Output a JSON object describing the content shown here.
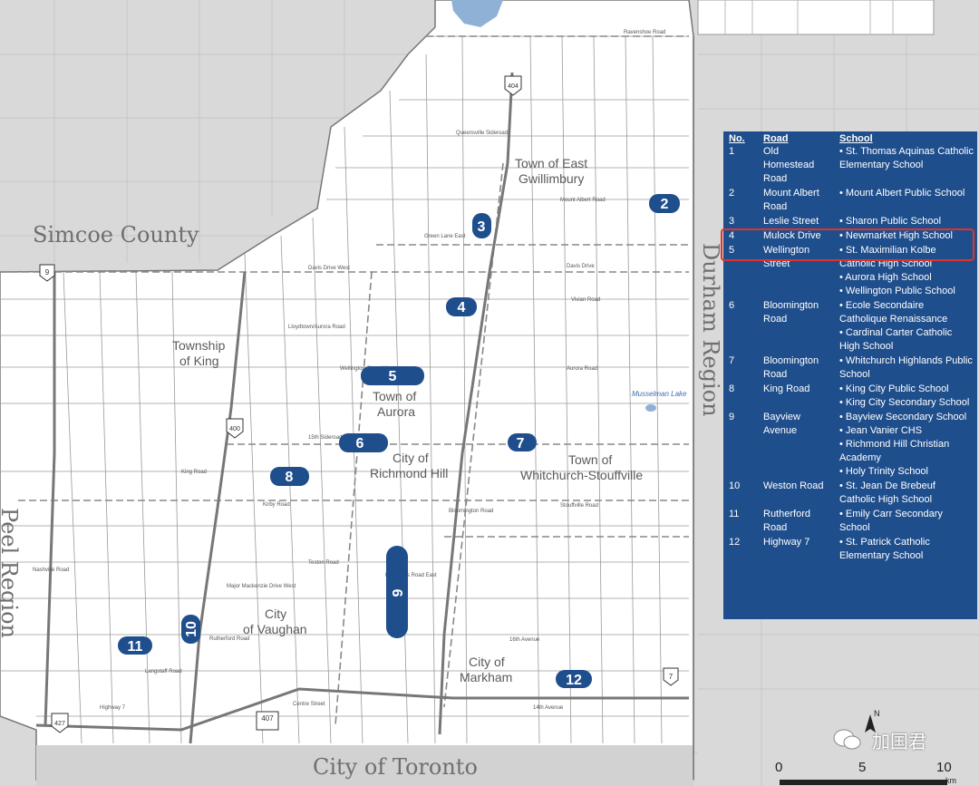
{
  "regions": {
    "simcoe": "Simcoe County",
    "durham": "Durham Region",
    "peel": "Peel Region",
    "toronto": "City of Toronto"
  },
  "towns": [
    {
      "id": "east_gwillimbury",
      "lines": [
        "Town of East",
        "Gwillimbury"
      ]
    },
    {
      "id": "king",
      "lines": [
        "Township",
        "of King"
      ]
    },
    {
      "id": "aurora",
      "lines": [
        "Town of",
        "Aurora"
      ]
    },
    {
      "id": "richmond_hill",
      "lines": [
        "City of",
        "Richmond Hill"
      ]
    },
    {
      "id": "whitchurch",
      "lines": [
        "Town of",
        "Whitchurch-Stouffville"
      ]
    },
    {
      "id": "vaughan",
      "lines": [
        "City",
        "of Vaughan"
      ]
    },
    {
      "id": "markham",
      "lines": [
        "City of",
        "Markham"
      ]
    }
  ],
  "streets": {
    "ravenshoe": "Ravenshoe Road",
    "davis": "Davis Drive West",
    "davis_e": "Davis Drive",
    "mount_albert": "Mount Albert Road",
    "green_lane": "Green Lane East",
    "aurora_rd": "Aurora Road",
    "stouffville_rd": "Stouffville Road",
    "king_rd": "King Road",
    "kirby_rd": "Kirby Road",
    "major_mackenzie": "Major Mackenzie Drive West",
    "teston": "Teston Road",
    "rutherford": "Rutherford Road",
    "langstaff": "Langstaff Road",
    "highway7": "Highway 7",
    "wellington": "Wellington Street West",
    "lloydtown": "Lloydtown/Aurora Road",
    "queensville": "Queensville Sideroad",
    "elgin_mills": "Elgin Mills Road East",
    "nashville": "Nashville Road",
    "sixteenth": "16th Avenue",
    "fourteenth": "14th Avenue",
    "vivian": "Vivian Road",
    "fifteenth": "15th Sideroad",
    "bloomington": "Bloomington Road",
    "centre": "Centre Street"
  },
  "highways": [
    {
      "id": "h404",
      "label": "404"
    },
    {
      "id": "h400",
      "label": "400"
    },
    {
      "id": "h9",
      "label": "9"
    },
    {
      "id": "h427",
      "label": "427"
    },
    {
      "id": "h407",
      "label": "407"
    },
    {
      "id": "h7",
      "label": "7"
    }
  ],
  "markers": [
    {
      "no": "2"
    },
    {
      "no": "3"
    },
    {
      "no": "4"
    },
    {
      "no": "5"
    },
    {
      "no": "6"
    },
    {
      "no": "7"
    },
    {
      "no": "8"
    },
    {
      "no": "9"
    },
    {
      "no": "10"
    },
    {
      "no": "11"
    },
    {
      "no": "12"
    }
  ],
  "lakes": {
    "musselman": "Musselman Lake"
  },
  "legend": {
    "headers": {
      "no": "No.",
      "road": "Road",
      "school": "School"
    },
    "rows": [
      {
        "no": "1",
        "road": "Old Homestead Road",
        "schools": [
          "• St. Thomas Aquinas Catholic Elementary School"
        ]
      },
      {
        "no": "2",
        "road": "Mount Albert Road",
        "schools": [
          "• Mount Albert Public School"
        ]
      },
      {
        "no": "3",
        "road": "Leslie Street",
        "schools": [
          "• Sharon Public School"
        ]
      },
      {
        "no": "4",
        "road": "Mulock Drive",
        "schools": [
          "• Newmarket High School"
        ]
      },
      {
        "no": "5",
        "road": "Wellington Street",
        "schools": [
          "• St. Maximilian Kolbe Catholic High School",
          "• Aurora High School",
          "• Wellington Public School"
        ]
      },
      {
        "no": "6",
        "road": "Bloomington Road",
        "schools": [
          "• Ecole Secondaire Catholique Renaissance",
          "• Cardinal Carter Catholic High School"
        ]
      },
      {
        "no": "7",
        "road": "Bloomington Road",
        "schools": [
          "• Whitchurch Highlands Public School"
        ]
      },
      {
        "no": "8",
        "road": "King Road",
        "schools": [
          "• King City Public School",
          "• King City Secondary School"
        ]
      },
      {
        "no": "9",
        "road": "Bayview Avenue",
        "schools": [
          "• Bayview Secondary School",
          "• Jean Vanier CHS",
          "• Richmond Hill Christian Academy",
          "• Holy Trinity School"
        ]
      },
      {
        "no": "10",
        "road": "Weston Road",
        "schools": [
          "• St. Jean De Brebeuf Catholic High School"
        ]
      },
      {
        "no": "11",
        "road": "Rutherford Road",
        "schools": [
          "• Emily Carr Secondary School"
        ]
      },
      {
        "no": "12",
        "road": "Highway 7",
        "schools": [
          "• St. Patrick Catholic Elementary School"
        ]
      }
    ]
  },
  "scale": {
    "ticks": [
      "0",
      "5",
      "10"
    ],
    "unit": "km"
  },
  "north": "N",
  "watermark": "加国君",
  "colors": {
    "accent": "#1f4e8c",
    "highlight": "#e0342a",
    "land": "#ffffff",
    "outside": "#d9d9d9",
    "water": "#8fb1d6"
  }
}
